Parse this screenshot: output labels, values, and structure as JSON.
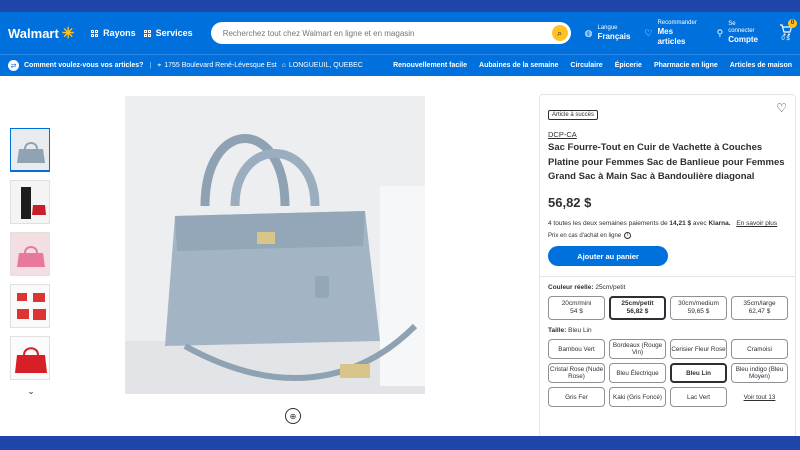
{
  "header": {
    "logo_text": "Walmart",
    "rayons": "Rayons",
    "services": "Services",
    "search_placeholder": "Recherchez tout chez Walmart en ligne et en magasin",
    "langue_label": "Langue",
    "langue_value": "Français",
    "recommander_label": "Recommander",
    "recommander_value": "Mes articles",
    "connect_label": "Se connecter",
    "connect_value": "Compte",
    "cart_count": "0",
    "cart_total": "0 $"
  },
  "subnav": {
    "question": "Comment voulez-vous vos articles?",
    "address": "1755 Boulevard René-Lévesque Est",
    "city": "LONGUEUIL, QUEBEC",
    "links": [
      "Renouvellement facile",
      "Aubaines de la semaine",
      "Circulaire",
      "Épicerie",
      "Pharmacie en ligne",
      "Articles de maison"
    ]
  },
  "product": {
    "badge": "Article à succès",
    "brand": "DCP-CA",
    "title": "Sac Fourre-Tout en Cuir de Vachette à Couches Platine pour Femmes Sac de Banlieue pour Femmes Grand Sac à Main Sac à Bandoulière diagonal",
    "price": "56,82 $",
    "klarna_text": "4 toutes les deux semaines paiements de",
    "klarna_amount": "14,21 $",
    "klarna_with": "avec",
    "klarna_brand": "Klarna.",
    "klarna_link": "En savoir plus",
    "pickup": "Prix en cas d'achat en ligne",
    "add_to_cart": "Ajouter au panier",
    "color_label": "Couleur réelle:",
    "color_value": "25cm/petit",
    "sizes": [
      {
        "name": "20cm/mini",
        "price": "54 $"
      },
      {
        "name": "25cm/petit",
        "price": "56,82 $"
      },
      {
        "name": "30cm/medium",
        "price": "59,65 $"
      },
      {
        "name": "35cm/large",
        "price": "62,47 $"
      }
    ],
    "taille_label": "Taille:",
    "taille_value": "Bleu Lin",
    "colors": [
      "Bambou Vert",
      "Bordeaux (Rouge Vin)",
      "Cerisier Fleur Rose",
      "Cramoisi",
      "Cristal Rose (Nude Rose)",
      "Bleu Électrique",
      "Bleu Lin",
      "Bleu indigo (Bleu Moyen)",
      "Gris Fer",
      "Kaki (Gris Foncé)",
      "Lac Vert",
      "Voir tout 13"
    ]
  },
  "colors": {
    "primary": "#0071dc",
    "accent": "#ffc220",
    "frame": "#1e46a8"
  }
}
